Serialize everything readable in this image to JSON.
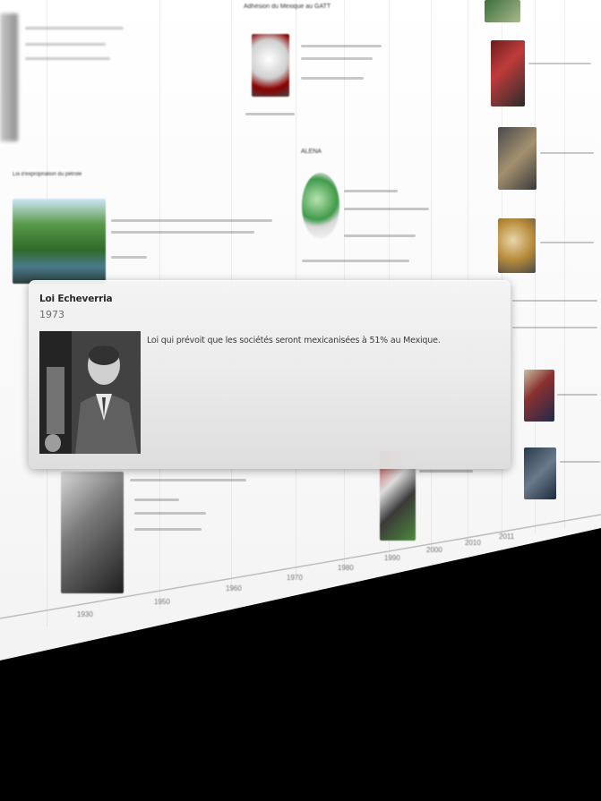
{
  "popup": {
    "title": "Loi Echeverria",
    "year": "1973",
    "description": "Loi qui prévoit que les sociétés seront mexicanisées à 51% au Mexique.",
    "photo_icon": "portrait-photo"
  },
  "background_cards": [
    {
      "label": "Adhésion du Mexique au GATT",
      "image": "gatt-logo"
    },
    {
      "label": "ALENA",
      "image": "globe-americas"
    },
    {
      "label": "Loi d'expropriation du pétrole",
      "image": "forest-river-photo"
    }
  ],
  "timeline": {
    "ticks": [
      "1930",
      "1950",
      "1960",
      "1970",
      "1980",
      "1990",
      "2000",
      "2010",
      "2011"
    ]
  },
  "colors": {
    "background": "#000000",
    "surface": "#f7f7f7",
    "popup": "#ececec"
  }
}
